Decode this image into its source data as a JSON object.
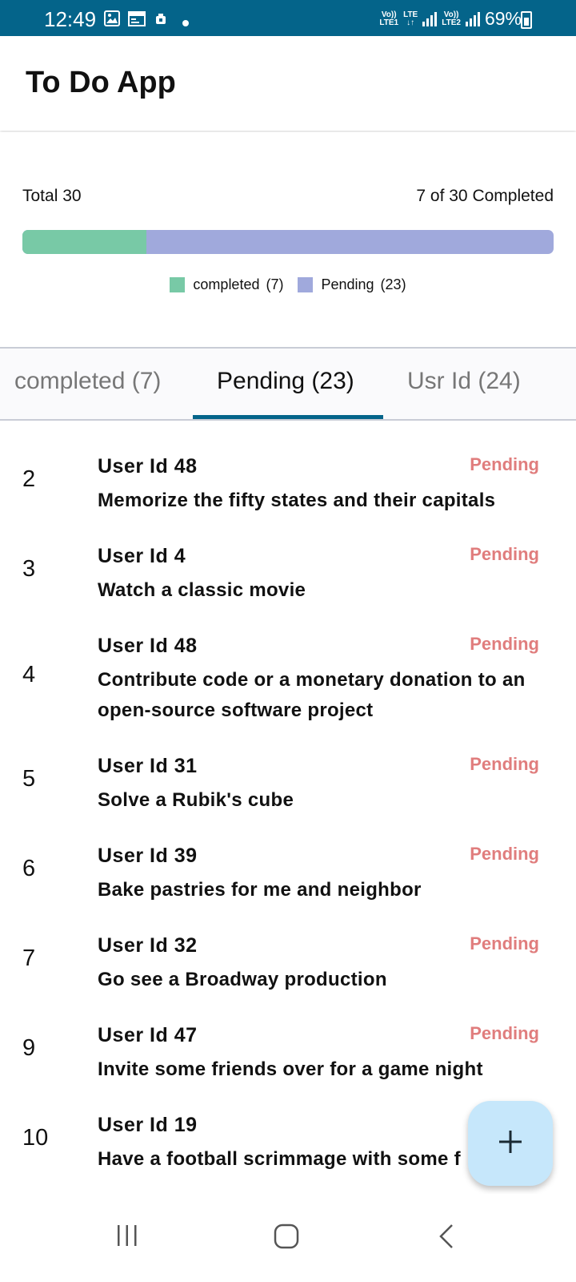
{
  "status_bar": {
    "time": "12:49",
    "net1_top": "Vo))",
    "net1_bottom": "LTE1",
    "lte": "LTE",
    "net2_top": "Vo))",
    "net2_bottom": "LTE2",
    "battery": "69%",
    "icons": [
      "image-icon",
      "calendar-icon",
      "notification-icon",
      "dot-icon",
      "signal-icon",
      "battery-icon"
    ]
  },
  "app_bar": {
    "title": "To Do App"
  },
  "summary": {
    "total_label": "Total 30",
    "completed_label": "7 of 30 Completed",
    "progress_completed_fraction": 0.2333,
    "legend": [
      {
        "label": "completed",
        "count": "(7)",
        "color": "#78c9a6"
      },
      {
        "label": "Pending",
        "count": "(23)",
        "color": "#a0a9dc"
      }
    ]
  },
  "tabs": [
    {
      "label": "completed (7)",
      "active": false
    },
    {
      "label": "Pending (23)",
      "active": true
    },
    {
      "label": "Usr Id (24)",
      "active": false
    }
  ],
  "list": [
    {
      "id": "2",
      "user": "User Id  48",
      "status": "Pending",
      "title": "Memorize the fifty states and their capitals"
    },
    {
      "id": "3",
      "user": "User Id  4",
      "status": "Pending",
      "title": "Watch a classic movie"
    },
    {
      "id": "4",
      "user": "User Id  48",
      "status": "Pending",
      "title": "Contribute code or a monetary donation to an open-source software project"
    },
    {
      "id": "5",
      "user": "User Id  31",
      "status": "Pending",
      "title": "Solve a Rubik's cube"
    },
    {
      "id": "6",
      "user": "User Id  39",
      "status": "Pending",
      "title": "Bake pastries for me and neighbor"
    },
    {
      "id": "7",
      "user": "User Id  32",
      "status": "Pending",
      "title": "Go see a Broadway production"
    },
    {
      "id": "9",
      "user": "User Id  47",
      "status": "Pending",
      "title": "Invite some friends over for a game night"
    },
    {
      "id": "10",
      "user": "User Id  19",
      "status": "",
      "title": "Have a football scrimmage with some f"
    }
  ],
  "fab": {
    "icon": "plus-icon"
  },
  "nav": {
    "icons": [
      "recent-apps-icon",
      "home-icon",
      "back-icon"
    ]
  },
  "colors": {
    "accent": "#04648a",
    "completed": "#78c9a6",
    "pending_bar": "#a0a9dc",
    "pending_text": "#e07d7d",
    "fab": "#c6e7fb"
  }
}
